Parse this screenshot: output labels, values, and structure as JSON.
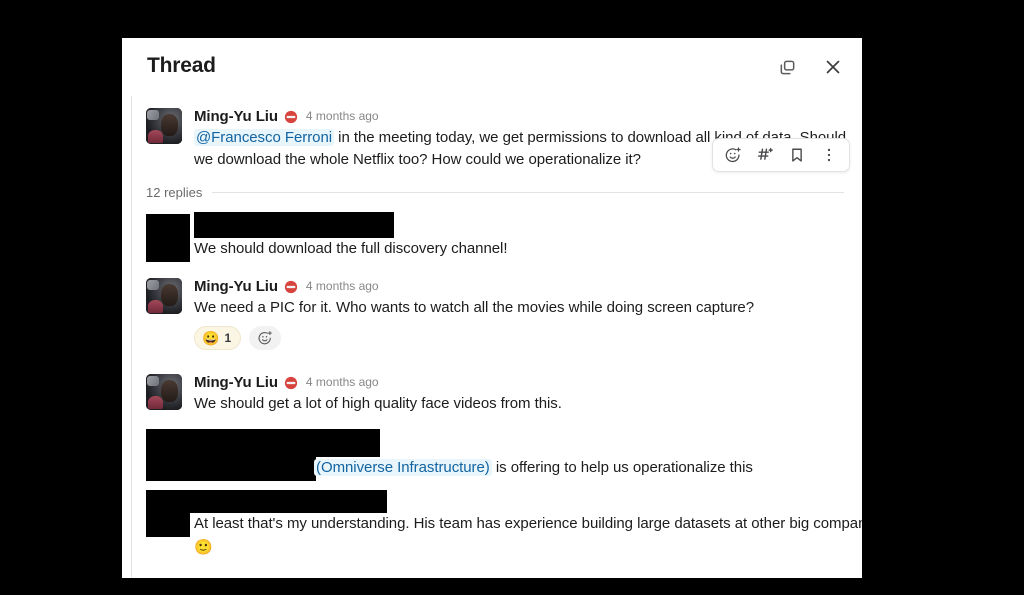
{
  "header": {
    "title": "Thread",
    "actions": [
      {
        "name": "open-in-new-window-icon",
        "label": "Open in new window"
      },
      {
        "name": "close-icon",
        "label": "Close"
      }
    ]
  },
  "hover_toolbar": {
    "items": [
      {
        "name": "add-reaction-icon",
        "label": "Add reaction"
      },
      {
        "name": "share-to-channel-icon",
        "label": "Share to channel"
      },
      {
        "name": "bookmark-icon",
        "label": "Save for later"
      },
      {
        "name": "more-actions-icon",
        "label": "More actions"
      }
    ]
  },
  "colors": {
    "mention_text": "#1264a3",
    "mention_bg": "#e8f5fa",
    "text": "#1d1c1d",
    "muted": "#878789",
    "panel_bg": "#ffffff",
    "page_bg": "#000000",
    "redaction": "#000000"
  },
  "root_message": {
    "author": "Ming-Yu Liu",
    "status_badge": "no-entry-emoji",
    "timestamp": "4 months ago",
    "mention": "@Francesco Ferroni",
    "text_after_mention": " in the meeting today, we get permissions to download all kind of data. Should we download the whole Netflix too? How could we operationalize it?"
  },
  "replies_divider": {
    "count_label": "12 replies"
  },
  "replies": [
    {
      "author_redacted": true,
      "avatar_redacted": true,
      "text": "We should download the full discovery channel!"
    },
    {
      "author": "Ming-Yu Liu",
      "status_badge": "no-entry-emoji",
      "timestamp": "4 months ago",
      "text": "We need a PIC for it. Who wants to watch all the movies while doing screen capture?",
      "reactions": [
        {
          "emoji": "grinning-face-emoji",
          "glyph": "😀",
          "count": "1"
        }
      ],
      "add_reaction": true
    },
    {
      "author": "Ming-Yu Liu",
      "status_badge": "no-entry-emoji",
      "timestamp": "4 months ago",
      "text": "We should get a lot of high quality face videos from this."
    },
    {
      "author_redacted": true,
      "avatar_redacted": true,
      "mention": "(Omniverse Infrastructure)",
      "text_after_mention": " is offering to help us operationalize this"
    },
    {
      "author_redacted": true,
      "avatar_redacted": true,
      "text": "At least that's my understanding. His team has experience building large datasets at other big companies ",
      "trailing_emoji": "slightly-smiling-face-emoji",
      "trailing_emoji_glyph": "🙂"
    }
  ]
}
